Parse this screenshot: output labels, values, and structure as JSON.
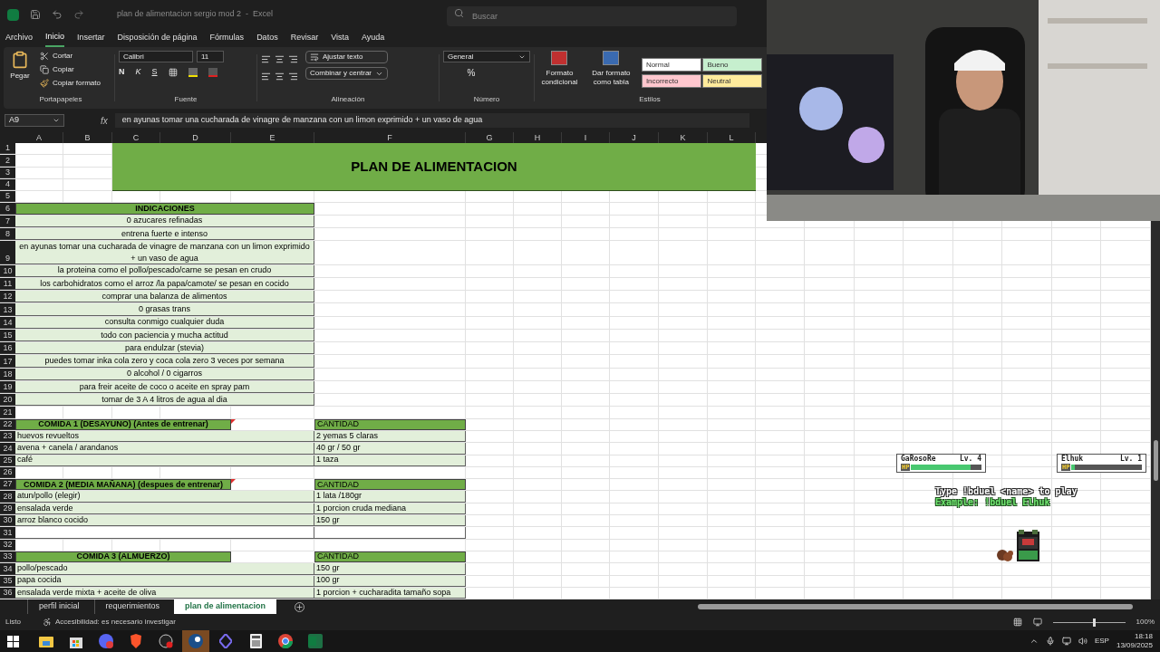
{
  "title_bar": {
    "title": "plan de alimentacion sergio mod 2  -  Excel",
    "search": {
      "placeholder": "Buscar"
    }
  },
  "menu": [
    {
      "label": "Archivo",
      "selected": false
    },
    {
      "label": "Inicio",
      "selected": true
    },
    {
      "label": "Insertar",
      "selected": false
    },
    {
      "label": "Disposición de página",
      "selected": false
    },
    {
      "label": "Fórmulas",
      "selected": false
    },
    {
      "label": "Datos",
      "selected": false
    },
    {
      "label": "Revisar",
      "selected": false
    },
    {
      "label": "Vista",
      "selected": false
    },
    {
      "label": "Ayuda",
      "selected": false
    }
  ],
  "ribbon": {
    "clipboard": {
      "paste": "Pegar",
      "cut": "Cortar",
      "copy": "Copiar",
      "format_painter": "Copiar formato",
      "label": "Portapapeles"
    },
    "font": {
      "name": "Calibri",
      "size": "11",
      "bold": "N",
      "italic": "K",
      "underline": "S",
      "label": "Fuente"
    },
    "alignment": {
      "wrap": "Ajustar texto",
      "merge": "Combinar y centrar",
      "label": "Alineación"
    },
    "number": {
      "format": "General",
      "percent": "%",
      "label": "Número"
    },
    "styles": {
      "conditional": "Formato condicional",
      "as_table": "Dar formato como tabla",
      "label": "Estilos",
      "cells": [
        {
          "label": "Normal",
          "color": "#ffffff"
        },
        {
          "label": "Bueno",
          "color": "#c6efce"
        },
        {
          "label": "Incorrecto",
          "color": "#ffc7ce"
        },
        {
          "label": "Neutral",
          "color": "#ffeb9c"
        }
      ]
    }
  },
  "formula_bar": {
    "cell": "A9",
    "fx": "fx",
    "value": "en ayunas tomar una cucharada de vinagre de manzana con un limon exprimido + un vaso de agua"
  },
  "sheet": {
    "columns": [
      "A",
      "B",
      "C",
      "D",
      "E",
      "F",
      "G",
      "H",
      "I",
      "J",
      "K",
      "L"
    ],
    "row_numbers": [
      "1",
      "2",
      "3",
      "4",
      "5",
      "6",
      "7",
      "8",
      "9",
      "10",
      "11",
      "12",
      "13",
      "14",
      "15",
      "16",
      "17",
      "18",
      "19",
      "20",
      "21",
      "22",
      "23",
      "24",
      "25",
      "26",
      "27",
      "28",
      "29",
      "30",
      "31",
      "32",
      "33",
      "34",
      "35",
      "36"
    ],
    "title": "PLAN DE ALIMENTACION",
    "indicaciones": {
      "header": "INDICACIONES",
      "items": [
        "0 azucares refinadas",
        "entrena fuerte e intenso",
        "en ayunas tomar una cucharada de vinagre de manzana con un limon exprimido + un vaso de agua",
        "la proteina como el pollo/pescado/carne se pesan en crudo",
        "los carbohidratos como el arroz /la papa/camote/ se pesan en cocido",
        "comprar una balanza de alimentos",
        "0 grasas trans",
        "consulta conmigo cualquier duda",
        "todo con paciencia y mucha actitud",
        "para endulzar (stevia)",
        "puedes tomar inka cola zero y coca cola zero 3 veces por semana",
        "0 alcohol / 0 cigarros",
        "para freir aceite de coco o aceite en spray pam",
        "tomar de 3 A 4  litros de agua al dia"
      ]
    },
    "meals": [
      {
        "header": "COMIDA 1 (DESAYUNO) (Antes de entrenar)",
        "quantity_header": "CANTIDAD",
        "has_comment": true,
        "trailing_blank": false,
        "items": [
          {
            "food": "huevos revueltos",
            "amount": "2 yemas 5 claras"
          },
          {
            "food": "avena + canela /  arandanos",
            "amount": "40 gr / 50 gr"
          },
          {
            "food": "café",
            "amount": "1 taza"
          }
        ]
      },
      {
        "header": "COMIDA 2 (MEDIA MAÑANA) (despues de entrenar)",
        "quantity_header": "CANTIDAD",
        "has_comment": true,
        "trailing_blank": true,
        "items": [
          {
            "food": "atun/pollo (elegir)",
            "amount": "1 lata  /180gr"
          },
          {
            "food": "ensalada verde",
            "amount": "1 porcion cruda mediana"
          },
          {
            "food": "arroz blanco cocido",
            "amount": "150 gr"
          }
        ]
      },
      {
        "header": "COMIDA 3 (ALMUERZO)",
        "quantity_header": "CANTIDAD",
        "has_comment": false,
        "trailing_blank": false,
        "items": [
          {
            "food": "pollo/pescado",
            "amount": "150 gr"
          },
          {
            "food": "papa cocida",
            "amount": "100 gr"
          },
          {
            "food": "ensalada verde mixta + aceite de oliva",
            "amount": "1 porcion + cucharadita tamaño sopa"
          }
        ]
      }
    ]
  },
  "sheet_tabs": [
    {
      "label": "perfil inicial",
      "selected": false
    },
    {
      "label": "requerimientos",
      "selected": false
    },
    {
      "label": "plan de alimentacion",
      "selected": true
    }
  ],
  "status": {
    "ready": "Listo",
    "accessibility": "Accesibilidad: es necesario investigar",
    "zoom": "100%",
    "zoom_slider": {
      "level": 0.55
    }
  },
  "game": {
    "players": [
      {
        "name": "GaRosoRe",
        "lv": "Lv. 4",
        "hp": "HP",
        "level": 0.85
      },
      {
        "name": "Elhuk",
        "lv": "Lv. 1",
        "hp": "HP",
        "level": 0.04
      }
    ],
    "prompt": "Type !bduel <name> to play",
    "example": "Example: !bduel Elhuk"
  },
  "taskbar": {
    "apps": [
      {
        "kind": "folder",
        "active": false
      },
      {
        "kind": "store",
        "active": false
      },
      {
        "kind": "chat",
        "active": false
      },
      {
        "kind": "shield",
        "active": false
      },
      {
        "kind": "record",
        "active": false
      },
      {
        "kind": "steam",
        "active": true
      },
      {
        "kind": "diamond",
        "active": false
      },
      {
        "kind": "calculator",
        "active": false
      },
      {
        "kind": "chrome",
        "active": false
      },
      {
        "kind": "excel",
        "active": false
      }
    ],
    "language": "ESP",
    "time": "18:18",
    "date": "13/09/2025"
  }
}
